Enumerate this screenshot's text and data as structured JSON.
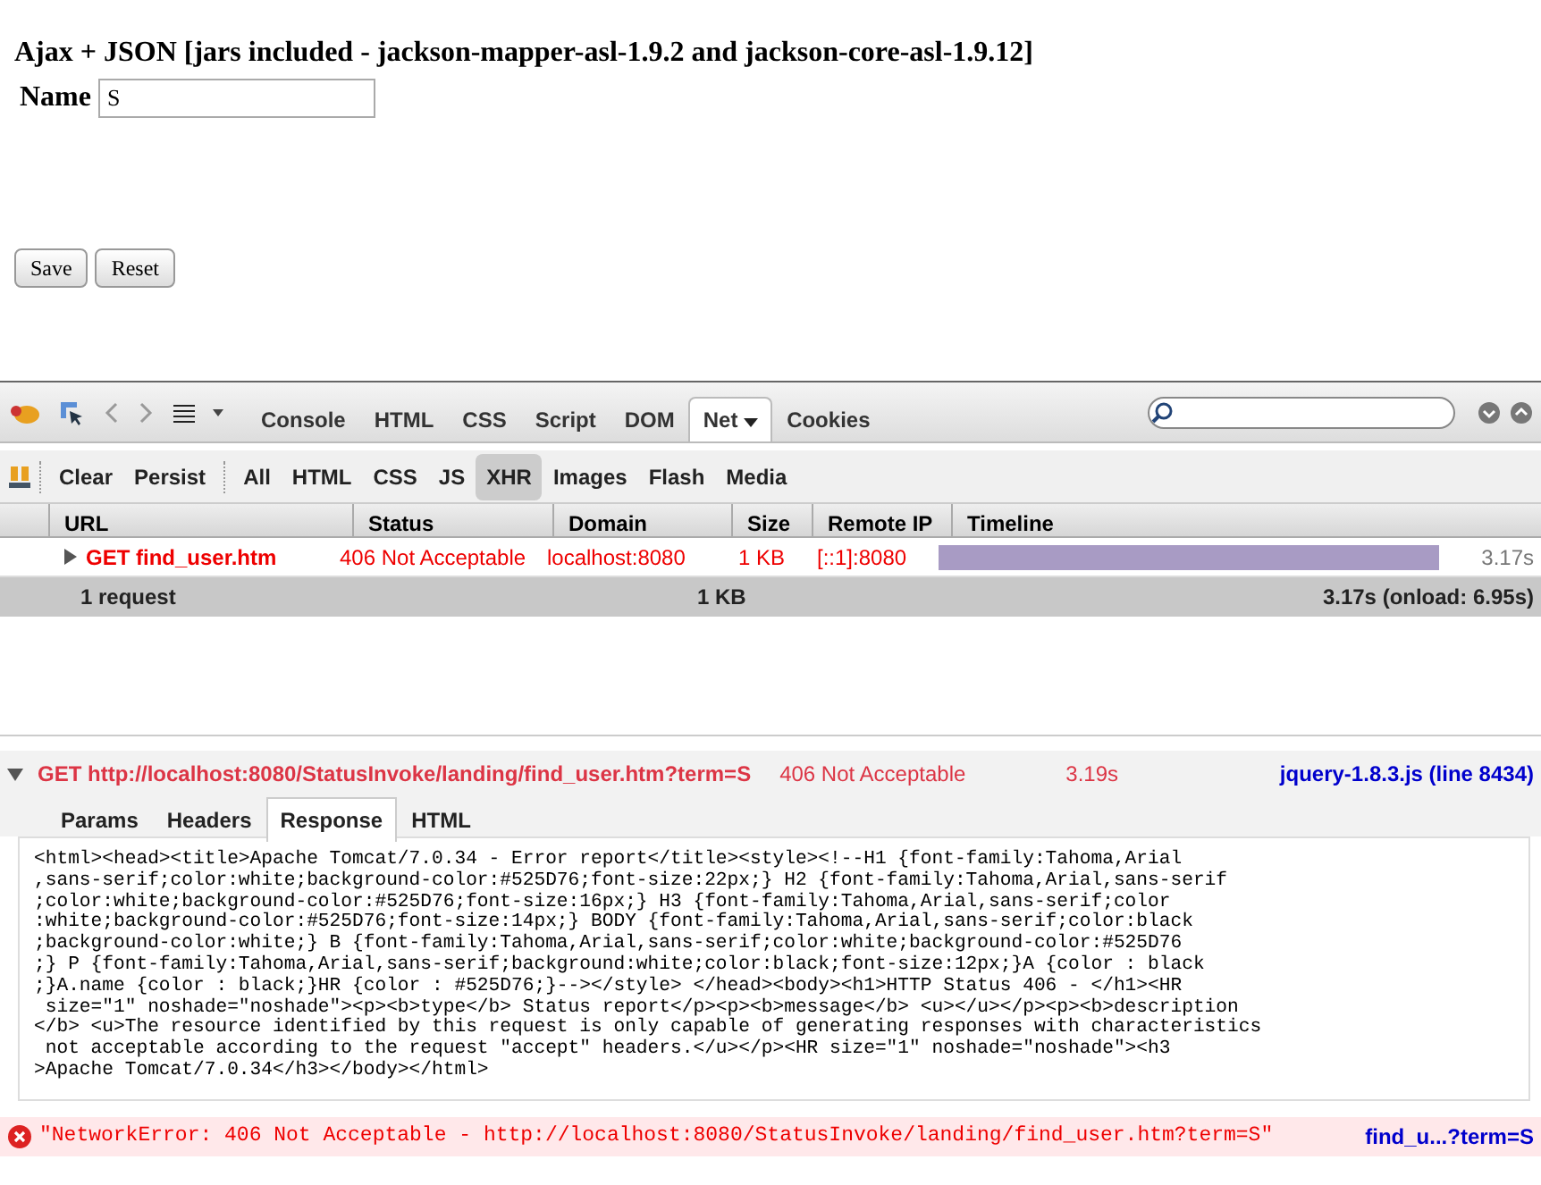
{
  "page": {
    "heading": "Ajax + JSON [jars included - jackson-mapper-asl-1.9.2 and jackson-core-asl-1.9.12]",
    "name_label": "Name",
    "name_value": "S",
    "buttons": [
      "Save",
      "Reset"
    ]
  },
  "firebug": {
    "panel_tabs": [
      {
        "label": "Console",
        "selected": false
      },
      {
        "label": "HTML",
        "selected": false
      },
      {
        "label": "CSS",
        "selected": false
      },
      {
        "label": "Script",
        "selected": false
      },
      {
        "label": "DOM",
        "selected": false
      },
      {
        "label": "Net",
        "selected": true
      },
      {
        "label": "Cookies",
        "selected": false
      }
    ],
    "net_actions": [
      "Clear",
      "Persist"
    ],
    "net_filters": [
      {
        "label": "All",
        "selected": false
      },
      {
        "label": "HTML",
        "selected": false
      },
      {
        "label": "CSS",
        "selected": false
      },
      {
        "label": "JS",
        "selected": false
      },
      {
        "label": "XHR",
        "selected": true
      },
      {
        "label": "Images",
        "selected": false
      },
      {
        "label": "Flash",
        "selected": false
      },
      {
        "label": "Media",
        "selected": false
      }
    ],
    "net_table": {
      "columns": [
        "URL",
        "Status",
        "Domain",
        "Size",
        "Remote IP",
        "Timeline"
      ],
      "rows": [
        {
          "url": "GET find_user.htm",
          "status": "406 Not Acceptable",
          "domain": "localhost:8080",
          "size": "1 KB",
          "remote_ip": "[::1]:8080",
          "level": 0.935,
          "time": "3.17s",
          "expanded": false
        }
      ],
      "summary": {
        "count": "1 request",
        "size": "1 KB",
        "time": "3.17s (onload: 6.95s)"
      }
    },
    "console_entry": {
      "expanded": true,
      "request": "GET http://localhost:8080/StatusInvoke/landing/find_user.htm?term=S",
      "status": "406 Not Acceptable",
      "time": "3.19s",
      "source": "jquery-1.8.3.js (line 8434)",
      "tabs": [
        {
          "label": "Params",
          "selected": false
        },
        {
          "label": "Headers",
          "selected": false
        },
        {
          "label": "Response",
          "selected": true
        },
        {
          "label": "HTML",
          "selected": false
        }
      ],
      "response": [
        "<html><head><title>Apache Tomcat/7.0.34 - Error report</title><style><!--H1 {font-family:Tahoma,Arial",
        ",sans-serif;color:white;background-color:#525D76;font-size:22px;} H2 {font-family:Tahoma,Arial,sans-serif",
        ";color:white;background-color:#525D76;font-size:16px;} H3 {font-family:Tahoma,Arial,sans-serif;color",
        ":white;background-color:#525D76;font-size:14px;} BODY {font-family:Tahoma,Arial,sans-serif;color:black",
        ";background-color:white;} B {font-family:Tahoma,Arial,sans-serif;color:white;background-color:#525D76",
        ";} P {font-family:Tahoma,Arial,sans-serif;background:white;color:black;font-size:12px;}A {color : black",
        ";}A.name {color : black;}HR {color : #525D76;}--></style> </head><body><h1>HTTP Status 406 - </h1><HR",
        " size=\"1\" noshade=\"noshade\"><p><b>type</b> Status report</p><p><b>message</b> <u></u></p><p><b>description",
        "</b> <u>The resource identified by this request is only capable of generating responses with characteristics",
        " not acceptable according to the request \"accept\" headers.</u></p><HR size=\"1\" noshade=\"noshade\"><h3",
        ">Apache Tomcat/7.0.34</h3></body></html>"
      ]
    },
    "error": {
      "message": "\"NetworkError: 406 Not Acceptable - http://localhost:8080/StatusInvoke/landing/find_user.htm?term=S\"",
      "source": "find_u...?term=S"
    }
  }
}
